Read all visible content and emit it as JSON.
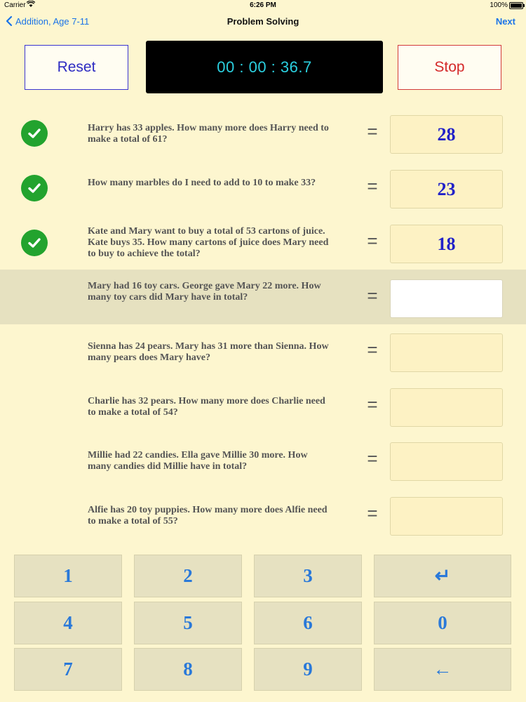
{
  "status_bar": {
    "carrier": "Carrier",
    "time": "6:26 PM",
    "battery": "100%"
  },
  "nav": {
    "back_label": "Addition, Age 7-11",
    "title": "Problem Solving",
    "next_label": "Next"
  },
  "controls": {
    "reset_label": "Reset",
    "timer": "00 : 00 : 36.7",
    "stop_label": "Stop"
  },
  "equals_sign": "=",
  "questions": [
    {
      "text": "Harry has 33 apples.  How many more does Harry need to make a total of 61?",
      "answer": "28",
      "correct": true
    },
    {
      "text": "How many marbles do I need to add to 10 to make 33?",
      "answer": "23",
      "correct": true
    },
    {
      "text": "Kate and Mary want to buy a total of 53 cartons of juice.  Kate buys 35.  How many cartons of juice does Mary need to buy to achieve the total?",
      "answer": "18",
      "correct": true
    },
    {
      "text": "Mary had 16 toy cars.  George gave Mary 22 more.  How many toy cars did Mary have in total?",
      "answer": "",
      "correct": false
    },
    {
      "text": "Sienna has 24 pears.  Mary has 31 more than Sienna.  How many pears does Mary have?",
      "answer": "",
      "correct": false
    },
    {
      "text": "Charlie has 32 pears.  How many more does Charlie need to make a total of 54?",
      "answer": "",
      "correct": false
    },
    {
      "text": "Millie had 22 candies.  Ella gave Millie 30 more.  How many candies did Millie have in total?",
      "answer": "",
      "correct": false
    },
    {
      "text": "Alfie has 20 toy puppies.  How many more does Alfie need to make a total of 55?",
      "answer": "",
      "correct": false
    }
  ],
  "keypad": {
    "keys": [
      "1",
      "2",
      "3",
      "↵",
      "4",
      "5",
      "6",
      "0",
      "7",
      "8",
      "9",
      "←"
    ]
  },
  "colors": {
    "background": "#fdf6cf",
    "accent_blue": "#1a73e8",
    "check_green": "#22a32e",
    "stop_red": "#d42a2a"
  }
}
